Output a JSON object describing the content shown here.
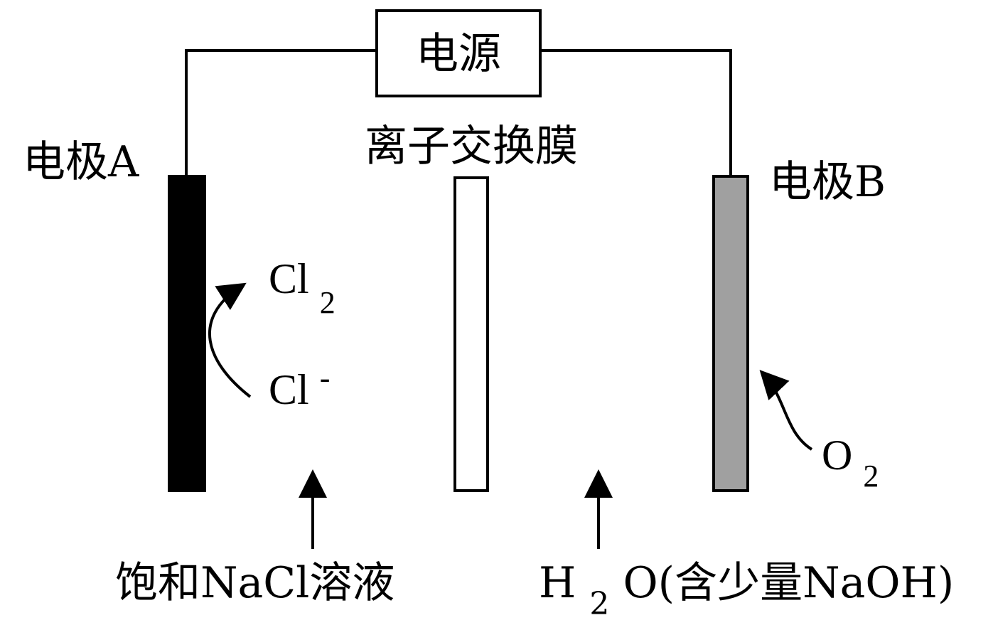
{
  "power_source": {
    "label": "电源"
  },
  "membrane": {
    "label": "离子交换膜"
  },
  "electrode_a": {
    "label": "电极A",
    "fill_color": "#000000"
  },
  "electrode_b": {
    "label": "电极B",
    "fill_color": "#a0a0a0"
  },
  "left_compartment": {
    "cl2": {
      "base": "Cl",
      "sub": "2"
    },
    "cl_ion": {
      "base": "Cl",
      "sup": "-"
    },
    "inlet_label": "饱和NaCl溶液"
  },
  "right_compartment": {
    "o2": {
      "base": "O",
      "sub": "2"
    },
    "inlet_label": {
      "h": "H",
      "sub": "2",
      "rest": "O(含少量NaOH)"
    }
  },
  "colors": {
    "line": "#000000",
    "membrane_fill": "#ffffff"
  }
}
